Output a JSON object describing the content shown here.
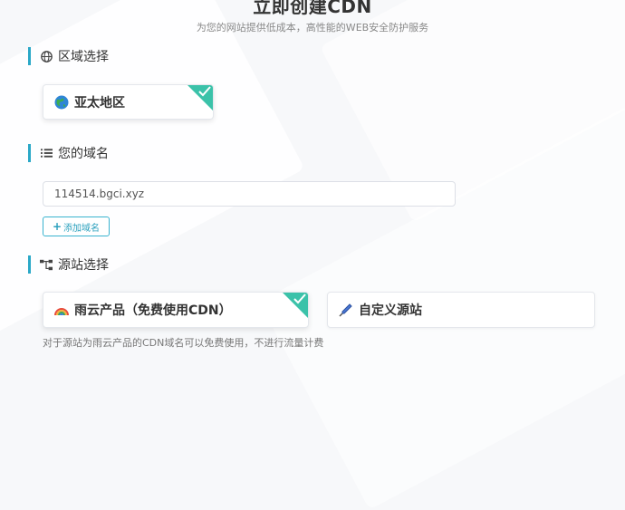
{
  "header": {
    "title": "立即创建CDN",
    "subtitle": "为您的网站提供低成本，高性能的WEB安全防护服务"
  },
  "sections": {
    "region": {
      "title": "区域选择",
      "icon": "globe-icon",
      "options": [
        {
          "label": "亚太地区",
          "icon": "earth-icon",
          "selected": true
        }
      ]
    },
    "domain": {
      "title": "您的域名",
      "icon": "list-icon",
      "input_value": "114514.bgci.xyz",
      "add_button": "添加域名"
    },
    "origin": {
      "title": "源站选择",
      "icon": "sitemap-icon",
      "options": [
        {
          "label": "雨云产品（免费使用CDN）",
          "icon": "rainbow-icon",
          "selected": true
        },
        {
          "label": "自定义源站",
          "icon": "syringe-icon",
          "selected": false
        }
      ],
      "note": "对于源站为雨云产品的CDN域名可以免费使用，不进行流量计费"
    }
  },
  "colors": {
    "accent": "#2aa8c7",
    "selected_corner": "#3bc2a9"
  }
}
